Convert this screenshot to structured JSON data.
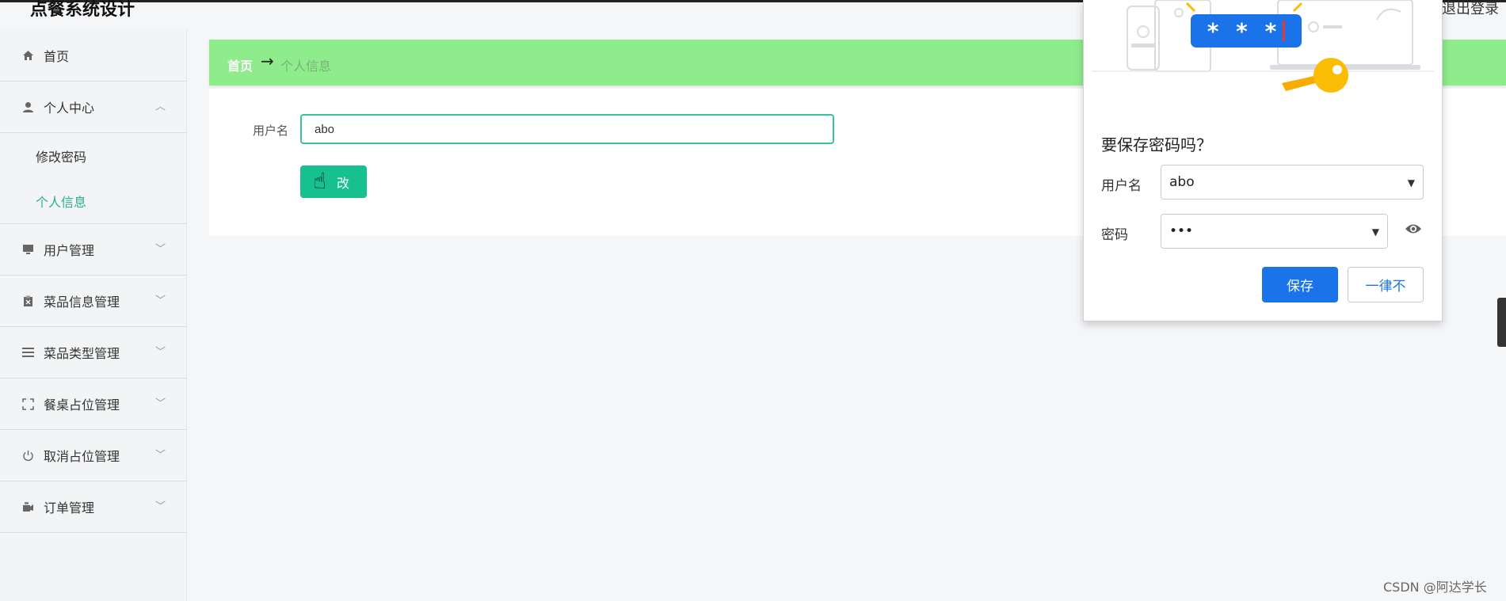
{
  "header": {
    "app_title": "点餐系统设计",
    "logout": "退出登录"
  },
  "sidebar": {
    "items": [
      {
        "label": "首页",
        "icon": "home-icon"
      },
      {
        "label": "个人中心",
        "icon": "user-icon",
        "expanded": true,
        "children": [
          {
            "label": "修改密码",
            "active": false
          },
          {
            "label": "个人信息",
            "active": true
          }
        ]
      },
      {
        "label": "用户管理",
        "icon": "monitor-icon"
      },
      {
        "label": "菜品信息管理",
        "icon": "clipboard-icon"
      },
      {
        "label": "菜品类型管理",
        "icon": "list-icon"
      },
      {
        "label": "餐桌占位管理",
        "icon": "fullscreen-icon"
      },
      {
        "label": "取消占位管理",
        "icon": "power-icon"
      },
      {
        "label": "订单管理",
        "icon": "money-icon"
      }
    ]
  },
  "breadcrumb": {
    "home": "首页",
    "separator": "→",
    "current": "个人信息"
  },
  "form": {
    "username_label": "用户名",
    "username_value": "abo",
    "submit_label": "改"
  },
  "save_password_popup": {
    "title": "要保存密码吗？",
    "username_label": "用户名",
    "username_value": "abo",
    "password_label": "密码",
    "password_value": "•••",
    "badge_text": "* * *",
    "save_button": "保存",
    "never_button": "一律不"
  },
  "watermark": "CSDN @阿达学长",
  "colors": {
    "breadcrumb_bg": "#8fec8c",
    "accent_green": "#17c08f",
    "active_menu": "#26b38f",
    "chrome_blue": "#1a73e8"
  }
}
